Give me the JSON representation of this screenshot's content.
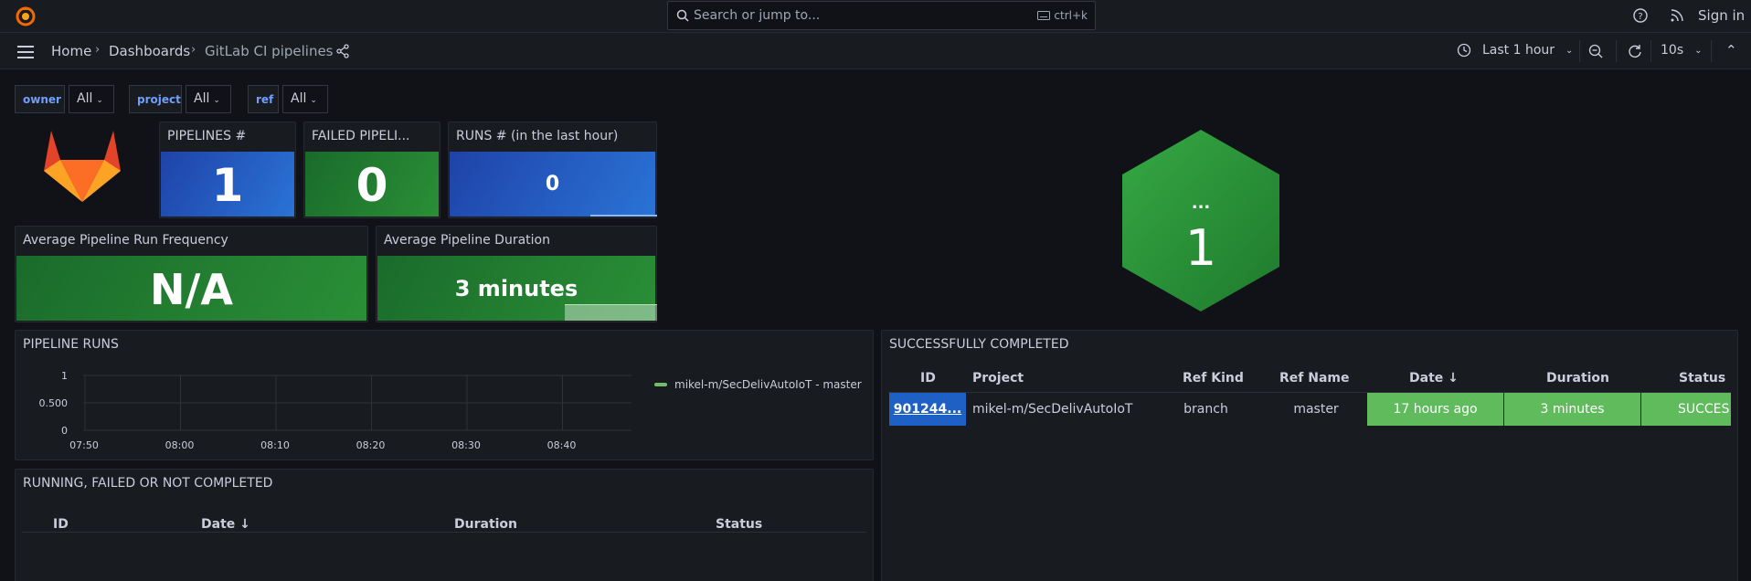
{
  "topbar": {
    "search_placeholder": "Search or jump to...",
    "search_shortcut": "ctrl+k",
    "signin_label": "Sign in"
  },
  "breadcrumb": {
    "home": "Home",
    "dashboards": "Dashboards",
    "current": "GitLab CI pipelines"
  },
  "toolbar": {
    "time_range": "Last 1 hour",
    "refresh_interval": "10s"
  },
  "variables": [
    {
      "name": "owner",
      "value": "All"
    },
    {
      "name": "project",
      "value": "All"
    },
    {
      "name": "ref",
      "value": "All"
    }
  ],
  "stats": {
    "pipelines": {
      "title": "PIPELINES #",
      "value": "1"
    },
    "failed": {
      "title": "FAILED PIPELI...",
      "value": "0"
    },
    "runs": {
      "title": "RUNS # (in the last hour)",
      "value": "0"
    },
    "frequency": {
      "title": "Average Pipeline Run Frequency",
      "value": "N/A"
    },
    "duration": {
      "title": "Average Pipeline Duration",
      "value": "3 minutes"
    }
  },
  "hexagon": {
    "label": "...",
    "value": "1"
  },
  "pipeline_runs": {
    "title": "PIPELINE RUNS",
    "legend": "mikel-m/SecDelivAutoIoT - master"
  },
  "chart_data": {
    "type": "line",
    "title": "PIPELINE RUNS",
    "x": [
      "07:50",
      "08:00",
      "08:10",
      "08:20",
      "08:30",
      "08:40"
    ],
    "yticks": [
      "1",
      "0.500",
      "0"
    ],
    "ylim": [
      0,
      1
    ],
    "series": [
      {
        "name": "mikel-m/SecDelivAutoIoT - master",
        "values": []
      }
    ],
    "legend": "right",
    "grid": true
  },
  "successful": {
    "title": "SUCCESSFULLY COMPLETED",
    "columns": [
      "ID",
      "Project",
      "Ref Kind",
      "Ref Name",
      "Date",
      "Duration",
      "Status"
    ],
    "rows": [
      {
        "id": "901244...",
        "project": "mikel-m/SecDelivAutoIoT",
        "ref_kind": "branch",
        "ref_name": "master",
        "date": "17 hours ago",
        "duration": "3 minutes",
        "status": "SUCCES"
      }
    ]
  },
  "running": {
    "title": "RUNNING, FAILED OR NOT COMPLETED",
    "columns": [
      "ID",
      "Date",
      "Duration",
      "Status"
    ]
  },
  "colors": {
    "accent": "#6e9fff",
    "green": "#299c46",
    "blue": "#1f60c4",
    "light_green": "#73bf69"
  }
}
